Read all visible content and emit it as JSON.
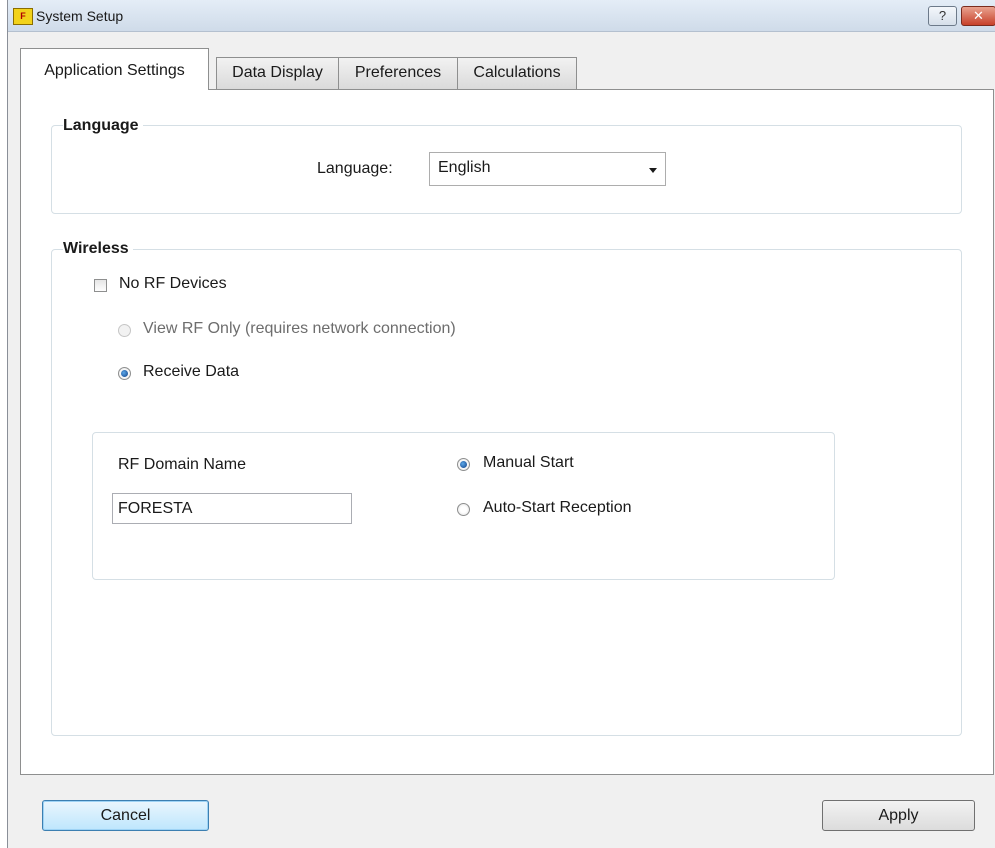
{
  "window": {
    "title": "System Setup",
    "help_label": "?",
    "close_label": "✕",
    "app_icon_letter": "F"
  },
  "tabs": [
    {
      "label": "Application Settings",
      "active": true
    },
    {
      "label": "Data Display",
      "active": false
    },
    {
      "label": "Preferences",
      "active": false
    },
    {
      "label": "Calculations",
      "active": false
    }
  ],
  "language_group": {
    "title": "Language",
    "field_label": "Language:",
    "selected_value": "English"
  },
  "wireless_group": {
    "title": "Wireless",
    "no_rf_devices": {
      "label": "No RF Devices",
      "checked": false
    },
    "view_rf_only": {
      "label": "View RF Only (requires network connection)",
      "checked": false,
      "enabled": false
    },
    "receive_data": {
      "label": "Receive Data",
      "checked": true
    },
    "rf_domain": {
      "label": "RF Domain Name",
      "value": "FORESTA"
    },
    "manual_start": {
      "label": "Manual Start",
      "checked": true
    },
    "auto_start": {
      "label": "Auto-Start Reception",
      "checked": false
    }
  },
  "buttons": {
    "cancel": "Cancel",
    "apply": "Apply"
  }
}
